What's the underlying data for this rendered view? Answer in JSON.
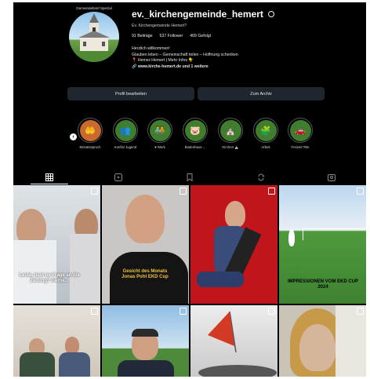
{
  "profile": {
    "avatar_caption": "Gemeindebrief Spezial",
    "username": "ev._kirchengemeinde_hemert",
    "subtitle": "Ev. Kirchengemeinde Hemert?",
    "stats": {
      "posts": "91 Beiträge",
      "followers": "537 Follower",
      "following": "409 Gefolgt"
    },
    "bio": [
      "Herzlich willkommen!",
      "Glauben leben – Gemeinschaft teilen – Hoffnung schenken",
      "📍 Hemer-Hemert | Mehr Infos 👇"
    ],
    "link": "www.kirche-hemert.de und 1 weitere"
  },
  "buttons": {
    "edit": "Profil bearbeiten",
    "archive": "Zum Archiv"
  },
  "highlights": [
    {
      "label": "Monatsspruch",
      "icon": "heart-hands-icon",
      "color": "#c9692e"
    },
    {
      "label": "Konfis/ Jugend",
      "icon": "group-icon",
      "color": "#3f7d2f"
    },
    {
      "label": "♥ Werk",
      "icon": "people-icon",
      "color": "#3f7d2f"
    },
    {
      "label": "Bodenhaus ...",
      "icon": "pig-icon",
      "color": "#3f7d2f"
    },
    {
      "label": "Kirchen ⛪",
      "icon": "church-icon",
      "color": "#3f7d2f"
    },
    {
      "label": "Arbeit",
      "icon": "puzzle-icon",
      "color": "#3f7d2f"
    },
    {
      "label": "Freizeit Tele",
      "icon": "car-icon",
      "color": "#3f7d2f"
    }
  ],
  "posts": [
    {
      "caption": "Leute, hast ne Frage an die Zeitung? Gerne..."
    },
    {
      "caption": "Gesicht des Monats Jonas Pohl EKD Cup"
    },
    {
      "caption": ""
    },
    {
      "caption": "IMPRESSIONEN VOM EKD CUP 2024"
    },
    {
      "caption": ""
    },
    {
      "caption": ""
    },
    {
      "caption": ""
    },
    {
      "caption": ""
    }
  ]
}
